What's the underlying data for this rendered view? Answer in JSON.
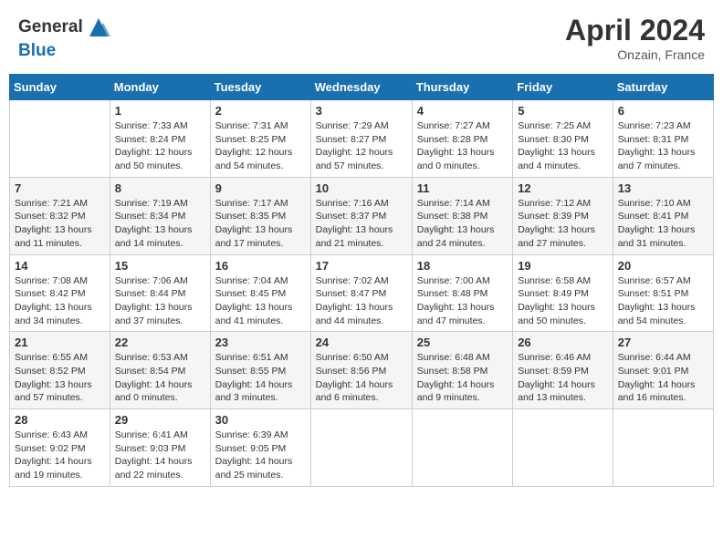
{
  "header": {
    "month": "April 2024",
    "location": "Onzain, France"
  },
  "columns": [
    "Sunday",
    "Monday",
    "Tuesday",
    "Wednesday",
    "Thursday",
    "Friday",
    "Saturday"
  ],
  "weeks": [
    [
      {
        "day": "",
        "info": ""
      },
      {
        "day": "1",
        "info": "Sunrise: 7:33 AM\nSunset: 8:24 PM\nDaylight: 12 hours\nand 50 minutes."
      },
      {
        "day": "2",
        "info": "Sunrise: 7:31 AM\nSunset: 8:25 PM\nDaylight: 12 hours\nand 54 minutes."
      },
      {
        "day": "3",
        "info": "Sunrise: 7:29 AM\nSunset: 8:27 PM\nDaylight: 12 hours\nand 57 minutes."
      },
      {
        "day": "4",
        "info": "Sunrise: 7:27 AM\nSunset: 8:28 PM\nDaylight: 13 hours\nand 0 minutes."
      },
      {
        "day": "5",
        "info": "Sunrise: 7:25 AM\nSunset: 8:30 PM\nDaylight: 13 hours\nand 4 minutes."
      },
      {
        "day": "6",
        "info": "Sunrise: 7:23 AM\nSunset: 8:31 PM\nDaylight: 13 hours\nand 7 minutes."
      }
    ],
    [
      {
        "day": "7",
        "info": "Sunrise: 7:21 AM\nSunset: 8:32 PM\nDaylight: 13 hours\nand 11 minutes."
      },
      {
        "day": "8",
        "info": "Sunrise: 7:19 AM\nSunset: 8:34 PM\nDaylight: 13 hours\nand 14 minutes."
      },
      {
        "day": "9",
        "info": "Sunrise: 7:17 AM\nSunset: 8:35 PM\nDaylight: 13 hours\nand 17 minutes."
      },
      {
        "day": "10",
        "info": "Sunrise: 7:16 AM\nSunset: 8:37 PM\nDaylight: 13 hours\nand 21 minutes."
      },
      {
        "day": "11",
        "info": "Sunrise: 7:14 AM\nSunset: 8:38 PM\nDaylight: 13 hours\nand 24 minutes."
      },
      {
        "day": "12",
        "info": "Sunrise: 7:12 AM\nSunset: 8:39 PM\nDaylight: 13 hours\nand 27 minutes."
      },
      {
        "day": "13",
        "info": "Sunrise: 7:10 AM\nSunset: 8:41 PM\nDaylight: 13 hours\nand 31 minutes."
      }
    ],
    [
      {
        "day": "14",
        "info": "Sunrise: 7:08 AM\nSunset: 8:42 PM\nDaylight: 13 hours\nand 34 minutes."
      },
      {
        "day": "15",
        "info": "Sunrise: 7:06 AM\nSunset: 8:44 PM\nDaylight: 13 hours\nand 37 minutes."
      },
      {
        "day": "16",
        "info": "Sunrise: 7:04 AM\nSunset: 8:45 PM\nDaylight: 13 hours\nand 41 minutes."
      },
      {
        "day": "17",
        "info": "Sunrise: 7:02 AM\nSunset: 8:47 PM\nDaylight: 13 hours\nand 44 minutes."
      },
      {
        "day": "18",
        "info": "Sunrise: 7:00 AM\nSunset: 8:48 PM\nDaylight: 13 hours\nand 47 minutes."
      },
      {
        "day": "19",
        "info": "Sunrise: 6:58 AM\nSunset: 8:49 PM\nDaylight: 13 hours\nand 50 minutes."
      },
      {
        "day": "20",
        "info": "Sunrise: 6:57 AM\nSunset: 8:51 PM\nDaylight: 13 hours\nand 54 minutes."
      }
    ],
    [
      {
        "day": "21",
        "info": "Sunrise: 6:55 AM\nSunset: 8:52 PM\nDaylight: 13 hours\nand 57 minutes."
      },
      {
        "day": "22",
        "info": "Sunrise: 6:53 AM\nSunset: 8:54 PM\nDaylight: 14 hours\nand 0 minutes."
      },
      {
        "day": "23",
        "info": "Sunrise: 6:51 AM\nSunset: 8:55 PM\nDaylight: 14 hours\nand 3 minutes."
      },
      {
        "day": "24",
        "info": "Sunrise: 6:50 AM\nSunset: 8:56 PM\nDaylight: 14 hours\nand 6 minutes."
      },
      {
        "day": "25",
        "info": "Sunrise: 6:48 AM\nSunset: 8:58 PM\nDaylight: 14 hours\nand 9 minutes."
      },
      {
        "day": "26",
        "info": "Sunrise: 6:46 AM\nSunset: 8:59 PM\nDaylight: 14 hours\nand 13 minutes."
      },
      {
        "day": "27",
        "info": "Sunrise: 6:44 AM\nSunset: 9:01 PM\nDaylight: 14 hours\nand 16 minutes."
      }
    ],
    [
      {
        "day": "28",
        "info": "Sunrise: 6:43 AM\nSunset: 9:02 PM\nDaylight: 14 hours\nand 19 minutes."
      },
      {
        "day": "29",
        "info": "Sunrise: 6:41 AM\nSunset: 9:03 PM\nDaylight: 14 hours\nand 22 minutes."
      },
      {
        "day": "30",
        "info": "Sunrise: 6:39 AM\nSunset: 9:05 PM\nDaylight: 14 hours\nand 25 minutes."
      },
      {
        "day": "",
        "info": ""
      },
      {
        "day": "",
        "info": ""
      },
      {
        "day": "",
        "info": ""
      },
      {
        "day": "",
        "info": ""
      }
    ]
  ]
}
